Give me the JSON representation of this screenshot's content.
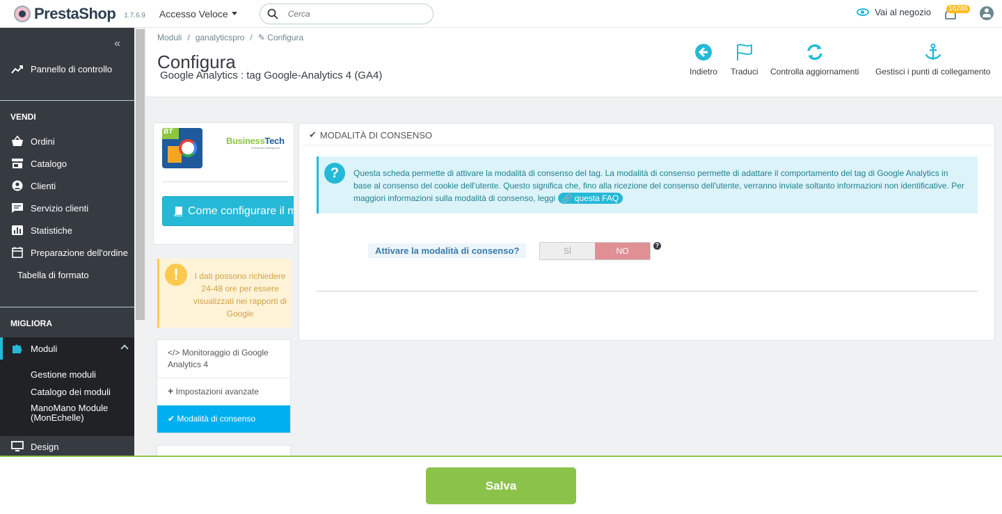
{
  "header": {
    "logo_text": "PrestaShop",
    "version": "1.7.6.9",
    "quick_access": "Accesso Veloce",
    "search_placeholder": "Cerca",
    "shop_link": "Vai al negozio",
    "notification_count": "16286"
  },
  "sidebar": {
    "dashboard": "Pannello di controllo",
    "sell_title": "VENDI",
    "sell_items": [
      "Ordini",
      "Catalogo",
      "Clienti",
      "Servizio clienti",
      "Statistiche",
      "Preparazione dell'ordine"
    ],
    "format_table": "Tabella di formato",
    "improve_title": "MIGLIORA",
    "modules": "Moduli",
    "module_sub": [
      "Gestione moduli",
      "Catalogo dei moduli",
      "ManoMano Module (MonEchelle)"
    ],
    "design": "Design"
  },
  "toolbar": {
    "breadcrumb": [
      "Moduli",
      "ganalyticspro",
      "Configura"
    ],
    "title": "Configura",
    "subtitle": "Google Analytics : tag Google-Analytics 4 (GA4)",
    "buttons": [
      "Indietro",
      "Traduci",
      "Controlla aggiornamenti",
      "Gestisci i punti di collegamento"
    ]
  },
  "module": {
    "badge": "BT",
    "brand_a": "Business",
    "brand_b": "Tech",
    "brand_tag": "E-business intelligence",
    "how_to": "Come configurare il mo",
    "warning": "I dati possono richiedere 24-48 ore per essere visualizzati nei rapporti di Google",
    "tabs": [
      "Monitoraggio di Google Analytics 4",
      "Impostazioni avanzate",
      "Modalità di consenso"
    ]
  },
  "panel": {
    "heading": "MODALITÀ DI CONSENSO",
    "info": "Questa scheda permette di attivare la modalità di consenso del tag. La modalità di consenso permette di adattare il comportamento del tag di Google Analytics in base al consenso del cookie dell'utente. Questo significa che, fino alla ricezione del consenso dell'utente, verranno inviate soltanto informazioni non identificative. Per maggiori informazioni sulla modalità di consenso, leggi",
    "faq_link": "questa FAQ",
    "question": "Attivare la modalità di consenso?",
    "yes": "SÌ",
    "no": "NO",
    "selected": "NO"
  },
  "footer": {
    "save": "Salva"
  },
  "colors": {
    "accent": "#25b9d7",
    "sidebar": "#363a41",
    "save": "#8bc34a",
    "no_active": "#e08f95",
    "warning": "#fcc94f"
  }
}
